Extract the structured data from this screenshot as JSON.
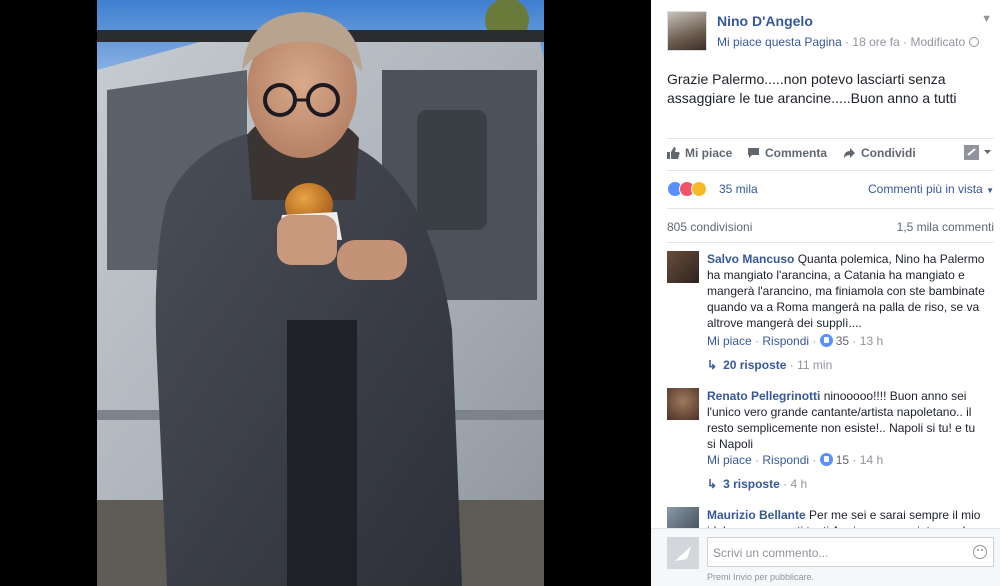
{
  "post": {
    "author": "Nino D'Angelo",
    "page_like_link": "Mi piace questa Pagina",
    "meta_sep": " · ",
    "time": "18 ore fa",
    "edited": "Modificato",
    "message": "Grazie Palermo.....non potevo lasciarti senza assaggiare le tue arancine.....Buon anno a tutti",
    "actions": {
      "like": "Mi piace",
      "comment": "Commenta",
      "share": "Condividi"
    },
    "reactions": {
      "count": "35 mila",
      "sort_label": "Commenti più in vista",
      "types": [
        "like",
        "love",
        "haha"
      ]
    },
    "shares": "805 condivisioni",
    "comments_count": "1,5 mila commenti"
  },
  "colors": {
    "link": "#365899",
    "like": "#5890ff",
    "love": "#f25268",
    "haha": "#f7b928"
  },
  "icons": [
    "chevron-down-icon",
    "globe-icon",
    "like-icon",
    "comment-icon",
    "share-icon",
    "share-menu-icon",
    "reply-arrow-icon",
    "camera-icon",
    "smiley-icon"
  ],
  "comments": [
    {
      "author": "Salvo Mancuso",
      "text": "Quanta polemica, Nino ha Palermo ha mangiato l'arancina, a Catania ha mangiato e mangerà l'arancino, ma finiamola con ste bambinate quando va a Roma mangerà na palla de riso, se va altrove mangerà dei supplì....",
      "like_label": "Mi piace",
      "reply_label": "Rispondi",
      "likes": "35",
      "time": "13 h",
      "replies": "20 risposte",
      "replies_time": "11 min"
    },
    {
      "author": "Renato Pellegrinotti",
      "text": "ninooooo!!!! Buon anno sei l'unico vero grande cantante/artista napoletano.. il resto semplicemente non esiste!.. Napoli si tu! e tu si Napoli",
      "like_label": "Mi piace",
      "reply_label": "Rispondi",
      "likes": "15",
      "time": "14 h",
      "replies": "3 risposte",
      "replies_time": "4 h"
    },
    {
      "author": "Maurizio Bellante",
      "text": "Per me sei e sarai sempre il mio idolo sono passati tanti Anni sono cresciuto con Le"
    }
  ],
  "composer": {
    "placeholder": "Scrivi un commento...",
    "hint": "Premi Invio per pubblicare."
  }
}
